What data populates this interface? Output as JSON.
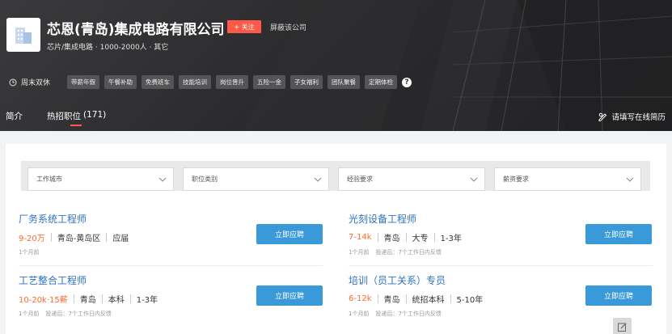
{
  "company": {
    "name": "芯恩(青岛)集成电路有限公司",
    "follow_label": "+ 关注",
    "block_label": "屏蔽该公司",
    "meta": "芯片/集成电路 · 1000-2000人 · 其它"
  },
  "welfare": {
    "schedule": "周末双休",
    "tags": [
      "带薪年假",
      "午餐补助",
      "免费班车",
      "技能培训",
      "岗位晋升",
      "五险一金",
      "子女福利",
      "团队聚餐",
      "定期体检"
    ]
  },
  "nav": {
    "tab_intro": "简介",
    "tab_jobs": "热招职位",
    "tab_jobs_count": "(171)",
    "resume_link": "请填写在线简历"
  },
  "filters": [
    "工作城市",
    "职位类别",
    "经验要求",
    "薪资要求"
  ],
  "jobs": [
    {
      "title": "厂务系统工程师",
      "salary": "9-20万",
      "location": "青岛-黄岛区",
      "edu": "应届",
      "exp": "",
      "time": "1个月前",
      "feedback": "",
      "apply": "立即应聘"
    },
    {
      "title": "光刻设备工程师",
      "salary": "7-14k",
      "location": "青岛",
      "edu": "大专",
      "exp": "1-3年",
      "time": "1个月前",
      "feedback": "投递后：7个工作日内反馈",
      "apply": "立即应聘"
    },
    {
      "title": "工艺整合工程师",
      "salary": "10-20k·15薪",
      "location": "青岛",
      "edu": "本科",
      "exp": "1-3年",
      "time": "1个月前",
      "feedback": "投递后：7个工作日内反馈",
      "apply": "立即应聘"
    },
    {
      "title": "培训（员工关系）专员",
      "salary": "6-12k",
      "location": "青岛",
      "edu": "统招本科",
      "exp": "5-10年",
      "time": "1个月前",
      "feedback": "投递后：7个工作日内反馈",
      "apply": "立即应聘"
    }
  ],
  "colors": {
    "accent": "#ff5a47",
    "link": "#2d72c2",
    "salary": "#ff6a2a",
    "button": "#3a9ad9"
  }
}
